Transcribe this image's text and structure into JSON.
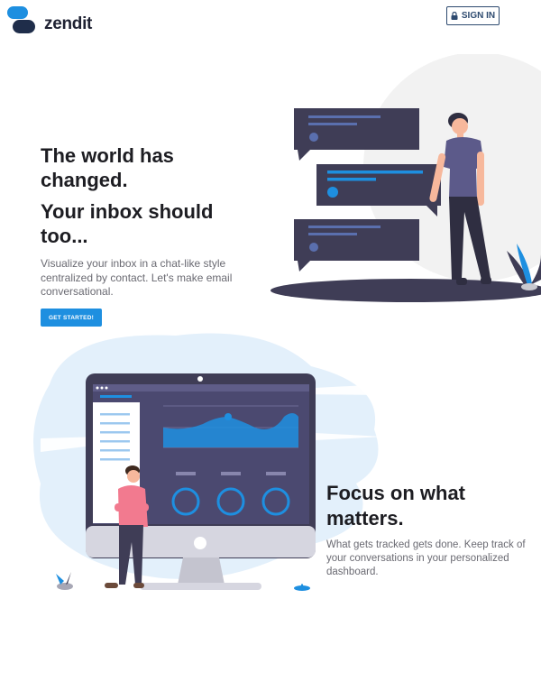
{
  "header": {
    "logo_text": "zendit",
    "signin_label": "SIGN IN",
    "logo_icon": "chat-bubbles-logo-icon",
    "signin_icon": "lock-icon"
  },
  "hero": {
    "title_line1": "The world has changed.",
    "title_line2": "Your inbox should too...",
    "description": "Visualize your inbox in a chat-like style centralized by contact. Let's make email conversational.",
    "cta_label": "GET STARTED!"
  },
  "feature": {
    "title": "Focus on what matters.",
    "description": "What gets tracked gets done. Keep track of your conversations in your personalized dashboard."
  },
  "colors": {
    "brand_blue": "#1e8fe0",
    "dark_navy": "#3f3d56",
    "signin_border": "#2d4a6f",
    "light_blue_blob": "#e3f0fb"
  }
}
